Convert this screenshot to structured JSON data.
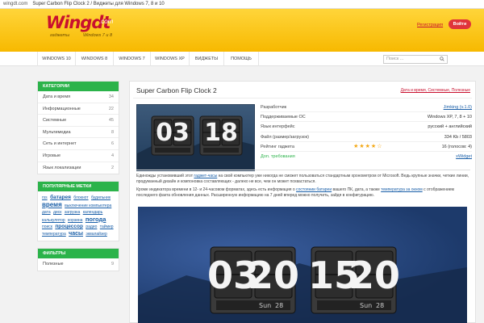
{
  "browser": {
    "url": "wingdt.com",
    "title": "Super Carbon Flip Clock 2 / Виджеты для Windows 7, 8 и 10"
  },
  "header": {
    "logo_name": "Wingdt",
    "logo_com": ".com",
    "logo_sub1": "гаджеты",
    "logo_sub2": "Windows 7 и 8",
    "register": "Регистрация",
    "login": "Войти",
    "brand_color": "#c8102e",
    "bar_color": "#ffc814"
  },
  "nav": {
    "items": [
      "WINDOWS 10",
      "WINDOWS 8",
      "WINDOWS 7",
      "WINDOWS XP",
      "ВИДЖЕТЫ",
      "ПОМОЩЬ"
    ],
    "search_placeholder": "Поиск ..."
  },
  "sidebar": {
    "categories_title": "КАТЕГОРИИ",
    "categories": [
      {
        "label": "Дата и время",
        "count": "34"
      },
      {
        "label": "Информационные",
        "count": "22"
      },
      {
        "label": "Системные",
        "count": "45"
      },
      {
        "label": "Мультимедиа",
        "count": "8"
      },
      {
        "label": "Сеть и интернет",
        "count": "6"
      },
      {
        "label": "Игровые",
        "count": "4"
      },
      {
        "label": "Язык локализации",
        "count": "2"
      }
    ],
    "tags_title": "ПОПУЛЯРНЫЕ МЕТКИ",
    "tags": [
      "rss",
      "батарея",
      "блокнот",
      "будильник",
      "время",
      "выключение компьютера",
      "дата",
      "диск",
      "загрузка",
      "календарь",
      "калькулятор",
      "корзина",
      "погода",
      "поиск",
      "процессор",
      "радио",
      "таймер",
      "температура",
      "часы",
      "эквалайзер"
    ],
    "filters_title": "ФИЛЬТРЫ",
    "filters": [
      {
        "label": "Полезные",
        "count": "9"
      }
    ],
    "accent": "#2bb34a"
  },
  "main": {
    "title": "Super Carbon Flip Clock 2",
    "breadcrumbs": "Дата и время, Системные, Полезные",
    "info": [
      {
        "label": "Разработчик",
        "value": "Jimking (v.1.0)",
        "link": true
      },
      {
        "label": "Поддерживаемые ОС",
        "value": "Windows XP, 7, 8 + 10",
        "link": false
      },
      {
        "label": "Язык интерфейс",
        "value": "русский + английский",
        "link": false
      },
      {
        "label": "Файл (размер/загрузок)",
        "value": "334 Kb / 5803",
        "link": false
      },
      {
        "label": "Рейтинг гаджета",
        "value": "16 (голосов: 4)",
        "link": false
      },
      {
        "label": "Доп. требования",
        "value": "xWidget",
        "link": true
      }
    ],
    "rating_stars": "★★★★☆",
    "description_1_a": "Единожды установивший этот ",
    "description_1_link": "гаджет-часы",
    "description_1_b": " на свой компьютер уже никогда не сможет пользоваться стандартным хронометром от Microsoft. Ведь крупные значки, четкие линии, продуманный дизайн и компоновка составляющих - далеко не все, чем он может похвастаться.",
    "description_2_a": "Кроме индикатора времени в 12- и 24-часовом форматах, здесь есть информация о ",
    "description_2_link": "состоянии батареи",
    "description_2_b": " вашего ПК, дата, а также ",
    "description_2_link2": "температура за окном",
    "description_2_c": " с отображением последнего факта обновления данных. Расширенную информацию на 7 дней вперед можно получить, зайдя в конфигурацию.",
    "thumb_clock": [
      "03",
      "18"
    ],
    "big_clock_1": [
      "03",
      "20"
    ],
    "big_clock_2": [
      "15",
      "20"
    ],
    "big_clock_day": "Sun",
    "big_clock_date": "28"
  }
}
